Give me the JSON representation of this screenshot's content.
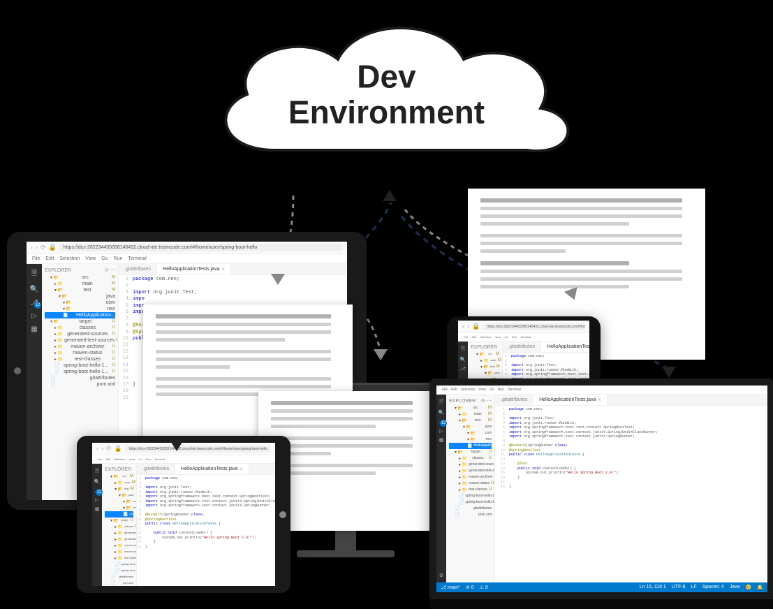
{
  "cloud": {
    "line1": "Dev",
    "line2": "Environment"
  },
  "url": "https://dcs-262234455056146432.cloud-ide.teamcode.com/#/home/user/spring-boot-hello",
  "menu": [
    "File",
    "Edit",
    "Selection",
    "View",
    "Go",
    "Run",
    "Terminal"
  ],
  "explorer_label": "EXPLORER",
  "refresh_icon": "⟳",
  "more_icon": "⋯",
  "badge_count": "12",
  "tree_large": [
    {
      "label": "src",
      "cls": "folder open",
      "lvl": 1,
      "status": "M"
    },
    {
      "label": "main",
      "cls": "folder",
      "lvl": 2,
      "status": "M"
    },
    {
      "label": "test",
      "cls": "folder open",
      "lvl": 2,
      "status": "M"
    },
    {
      "label": "java",
      "cls": "folder open",
      "lvl": 3
    },
    {
      "label": "com",
      "cls": "folder open",
      "lvl": 4
    },
    {
      "label": "neo",
      "cls": "folder open",
      "lvl": 4
    },
    {
      "label": "HelloApplication...",
      "cls": "file selected",
      "lvl": 4
    },
    {
      "label": "target",
      "cls": "folder open",
      "lvl": 1,
      "status": "U"
    },
    {
      "label": "classes",
      "cls": "folder",
      "lvl": 2,
      "status": "U"
    },
    {
      "label": "generated-sources",
      "cls": "folder",
      "lvl": 2,
      "status": "U"
    },
    {
      "label": "generated-test-sources",
      "cls": "folder",
      "lvl": 2,
      "status": "U"
    },
    {
      "label": "maven-archiver",
      "cls": "folder",
      "lvl": 2,
      "status": "U"
    },
    {
      "label": "maven-status",
      "cls": "folder",
      "lvl": 2,
      "status": "U"
    },
    {
      "label": "test-classes",
      "cls": "folder",
      "lvl": 2,
      "status": "U"
    },
    {
      "label": "spring-boot-hello-1...",
      "cls": "file",
      "lvl": 2,
      "status": "U"
    },
    {
      "label": "spring-boot-hello-1...",
      "cls": "file",
      "lvl": 2,
      "status": "U"
    },
    {
      "label": ".gitattributes",
      "cls": "file",
      "lvl": 1
    },
    {
      "label": "pom.xml",
      "cls": "file",
      "lvl": 1
    }
  ],
  "tree_laptop": [
    {
      "label": "src",
      "cls": "folder open",
      "lvl": 1,
      "status": "M"
    },
    {
      "label": "main",
      "cls": "folder",
      "lvl": 2,
      "status": "M"
    },
    {
      "label": "test",
      "cls": "folder open",
      "lvl": 2,
      "status": "M"
    },
    {
      "label": "java",
      "cls": "folder open",
      "lvl": 3
    },
    {
      "label": "com",
      "cls": "folder open",
      "lvl": 4
    },
    {
      "label": "neo",
      "cls": "folder open",
      "lvl": 4
    },
    {
      "label": "HelloApplicatio...",
      "cls": "file selected",
      "lvl": 4
    },
    {
      "label": "target",
      "cls": "folder open",
      "lvl": 1,
      "status": "U"
    },
    {
      "label": "classes",
      "cls": "folder",
      "lvl": 2,
      "status": "U"
    },
    {
      "label": "generated-sources",
      "cls": "folder",
      "lvl": 2,
      "status": "U"
    },
    {
      "label": "generated-test-sources",
      "cls": "folder",
      "lvl": 2,
      "status": "U"
    },
    {
      "label": "maven-archiver",
      "cls": "folder",
      "lvl": 2,
      "status": "U"
    },
    {
      "label": "maven-status",
      "cls": "folder",
      "lvl": 2,
      "status": "U"
    },
    {
      "label": "test-classes",
      "cls": "folder",
      "lvl": 2,
      "status": "U"
    },
    {
      "label": "spring-boot-hello-1...",
      "cls": "file",
      "lvl": 2,
      "status": "U"
    },
    {
      "label": "spring-boot-hello-1...",
      "cls": "file",
      "lvl": 2,
      "status": "U"
    },
    {
      "label": ".gitattributes",
      "cls": "file",
      "lvl": 1
    },
    {
      "label": "pom.xml",
      "cls": "file",
      "lvl": 1
    }
  ],
  "tabs": [
    {
      "label": ".gitattributes"
    },
    {
      "label": "HelloApplicationTests.java",
      "active": true
    }
  ],
  "code_short": [
    {
      "n": 1,
      "h": "<span class='c-kw'>package</span> com.neo;"
    },
    {
      "n": 2,
      "h": ""
    },
    {
      "n": 3,
      "h": "<span class='c-kw'>import</span> org.junit.Test;"
    },
    {
      "n": 4,
      "h": "<span class='c-kw'>impo</span>"
    },
    {
      "n": 5,
      "h": "<span class='c-kw'>impo</span>"
    },
    {
      "n": 6,
      "h": "<span class='c-kw'>impo</span>"
    },
    {
      "n": 7,
      "h": ""
    },
    {
      "n": 8,
      "h": "<span class='c-ann'>@Run</span>"
    },
    {
      "n": 9,
      "h": "<span class='c-ann'>@Spr</span>"
    },
    {
      "n": 10,
      "h": "<span class='c-kw'>publ</span>"
    },
    {
      "n": 11,
      "h": ""
    },
    {
      "n": 12,
      "h": ""
    },
    {
      "n": 13,
      "h": ""
    },
    {
      "n": 14,
      "h": ""
    },
    {
      "n": 15,
      "h": ""
    },
    {
      "n": 16,
      "h": ""
    },
    {
      "n": 17,
      "h": "}"
    },
    {
      "n": 18,
      "h": ""
    },
    {
      "n": 19,
      "h": ""
    }
  ],
  "code_full": [
    {
      "n": 1,
      "h": "<span class='c-kw'>package</span> com.neo;"
    },
    {
      "n": 2,
      "h": ""
    },
    {
      "n": 3,
      "h": "<span class='c-kw'>import</span> org.junit.Test;"
    },
    {
      "n": 4,
      "h": "<span class='c-kw'>import</span> org.junit.runner.RunWith;"
    },
    {
      "n": 5,
      "h": "<span class='c-kw'>import</span> org.springframework.boot.test.context.SpringBootTest;"
    },
    {
      "n": 6,
      "h": "<span class='c-kw'>import</span> org.springframework.test.context.junit4.SpringJUnit4ClassRunner;"
    },
    {
      "n": 7,
      "h": "<span class='c-kw'>import</span> org.springframework.test.context.junit4.SpringRunner;"
    },
    {
      "n": 8,
      "h": ""
    },
    {
      "n": 9,
      "h": "<span class='c-ann'>@RunWith</span>(SpringRunner.<span class='c-kw'>class</span>)"
    },
    {
      "n": 10,
      "h": "<span class='c-ann'>@SpringBootTest</span>"
    },
    {
      "n": 11,
      "h": "<span class='c-kw'>public class</span> <span class='c-cls'>HelloApplicationTests</span> {"
    },
    {
      "n": 12,
      "h": ""
    },
    {
      "n": 13,
      "h": "    <span class='c-ann'>@Test</span>"
    },
    {
      "n": 14,
      "h": "    <span class='c-kw'>public void</span> contextLoads() {"
    },
    {
      "n": 15,
      "h": "        System.out.println(<span class='c-str'>\"Hello Spring Boot 2.0!\"</span>);"
    },
    {
      "n": 16,
      "h": "    }"
    },
    {
      "n": 17,
      "h": ""
    },
    {
      "n": 18,
      "h": "}"
    }
  ],
  "code_mini": [
    {
      "n": 1,
      "h": "<span class='c-kw'>package</span> com.neo;"
    },
    {
      "n": 2,
      "h": ""
    },
    {
      "n": 3,
      "h": "<span class='c-kw'>import</span> org.junit.Test;"
    },
    {
      "n": 4,
      "h": "<span class='c-kw'>import</span> org.junit.runner.RunWith;"
    },
    {
      "n": 5,
      "h": "<span class='c-kw'>import</span> org.springframework.boot.test.context.SpringBootTest;"
    },
    {
      "n": 6,
      "h": "<span class='c-kw'>import</span> org.springframework.test.context.junit4.SpringJUnit4ClassRunner;"
    },
    {
      "n": 7,
      "h": "<span class='c-kw'>import</span> org.springframework.test.context.junit4.SpringRunner;"
    },
    {
      "n": 8,
      "h": ""
    },
    {
      "n": 9,
      "h": "<span class='c-ann'>@RunWith</span>(SpringRunner.<span class='c-kw'>class</span>)"
    },
    {
      "n": 10,
      "h": "<span class='c-ann'>@SpringBootTest</span>"
    },
    {
      "n": 11,
      "h": "<span class='c-kw'>public class</span> <span class='c-cls'>HelloApplicationTests</span> {"
    },
    {
      "n": 12,
      "h": ""
    },
    {
      "n": 13,
      "h": "    <span class='c-kw'>public void</span> contextLoads() {"
    },
    {
      "n": 14,
      "h": "        System.out.println(<span class='c-str'>\"Hello Spring Boot 2.0!\"</span>);"
    },
    {
      "n": 15,
      "h": "    }"
    },
    {
      "n": 16,
      "h": "}"
    }
  ],
  "status": {
    "left": [
      "⎇ main*",
      "⊘ 0",
      "⚠ 0"
    ],
    "right": [
      "Ln 15, Col 1",
      "UTF-8",
      "LF",
      "Spaces: 4",
      "Java",
      "😊",
      "🔔"
    ]
  }
}
